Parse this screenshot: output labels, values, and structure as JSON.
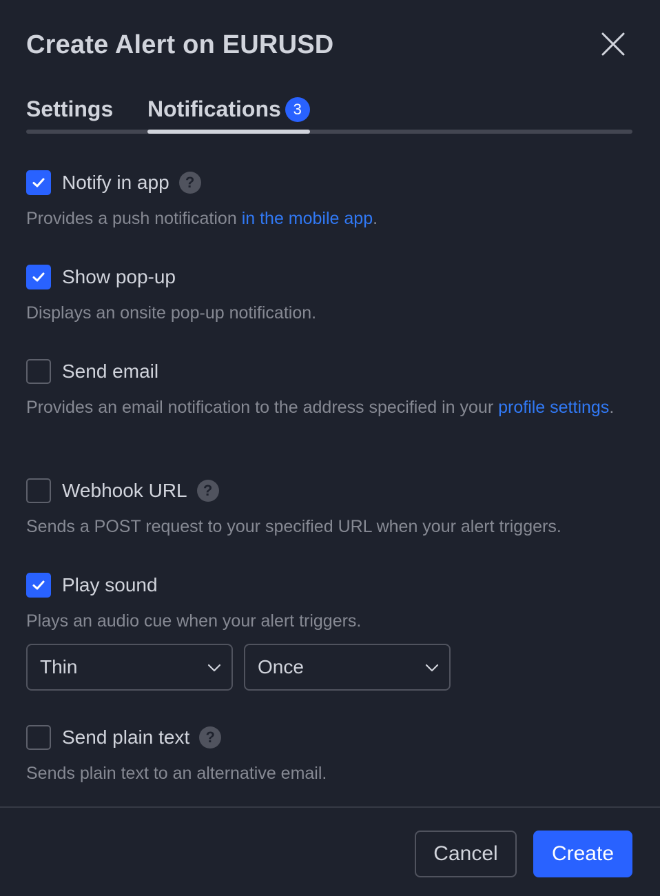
{
  "dialog": {
    "title": "Create Alert on EURUSD"
  },
  "tabs": [
    {
      "label": "Settings",
      "active": false
    },
    {
      "label": "Notifications",
      "active": true,
      "badge": "3"
    }
  ],
  "options": [
    {
      "label": "Notify in app",
      "checked": true,
      "help": "?",
      "desc_pre": "Provides a push notification ",
      "desc_link": "in the mobile app",
      "desc_post": "."
    },
    {
      "label": "Show pop-up",
      "checked": true,
      "desc": "Displays an onsite pop-up notification."
    },
    {
      "label": "Send email",
      "checked": false,
      "desc_pre": "Provides an email notification to the address specified in your ",
      "desc_link": "profile settings",
      "desc_post": "."
    },
    {
      "label": "Webhook URL",
      "checked": false,
      "help": "?",
      "desc": "Sends a POST request to your specified URL when your alert triggers."
    },
    {
      "label": "Play sound",
      "checked": true,
      "desc": "Plays an audio cue when your alert triggers."
    },
    {
      "label": "Send plain text",
      "checked": false,
      "help": "?",
      "desc": "Sends plain text to an alternative email."
    }
  ],
  "sound": {
    "sound_value": "Thin",
    "repeat_value": "Once"
  },
  "footer": {
    "cancel_label": "Cancel",
    "create_label": "Create"
  },
  "colors": {
    "background": "#1e222d",
    "accent": "#2962ff",
    "link": "#3179f5",
    "text": "#d1d4dc",
    "muted": "#868993"
  },
  "icons": {
    "close": "close-icon",
    "check": "checkmark-icon",
    "help": "question-mark-icon",
    "chevron": "chevron-down-icon"
  }
}
